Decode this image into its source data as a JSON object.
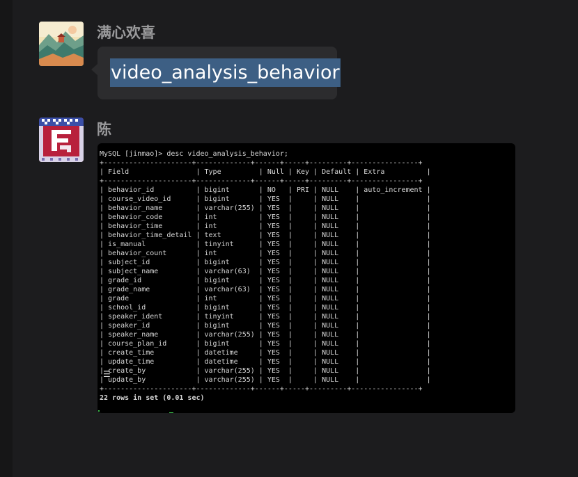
{
  "chat": {
    "messages": [
      {
        "sender": "满心欢喜",
        "text": "video_analysis_behavior",
        "avatar": "landscape-painting-avatar"
      },
      {
        "sender": "陈",
        "avatar": "pixel-art-avatar"
      }
    ]
  },
  "terminal": {
    "command": "MySQL [jinmao]> desc video_analysis_behavior;",
    "separator": "+---------------------+-------------+------+-----+---------+----------------+",
    "columns": [
      "Field",
      "Type",
      "Null",
      "Key",
      "Default",
      "Extra"
    ],
    "rows": [
      [
        "behavior_id",
        "bigint",
        "NO",
        "PRI",
        "NULL",
        "auto_increment"
      ],
      [
        "course_video_id",
        "bigint",
        "YES",
        "",
        "NULL",
        ""
      ],
      [
        "behavior_name",
        "varchar(255)",
        "YES",
        "",
        "NULL",
        ""
      ],
      [
        "behavior_code",
        "int",
        "YES",
        "",
        "NULL",
        ""
      ],
      [
        "behavior_time",
        "int",
        "YES",
        "",
        "NULL",
        ""
      ],
      [
        "behavior_time_detail",
        "text",
        "YES",
        "",
        "NULL",
        ""
      ],
      [
        "is_manual",
        "tinyint",
        "YES",
        "",
        "NULL",
        ""
      ],
      [
        "behavior_count",
        "int",
        "YES",
        "",
        "NULL",
        ""
      ],
      [
        "subject_id",
        "bigint",
        "YES",
        "",
        "NULL",
        ""
      ],
      [
        "subject_name",
        "varchar(63)",
        "YES",
        "",
        "NULL",
        ""
      ],
      [
        "grade_id",
        "bigint",
        "YES",
        "",
        "NULL",
        ""
      ],
      [
        "grade_name",
        "varchar(63)",
        "YES",
        "",
        "NULL",
        ""
      ],
      [
        "grade",
        "int",
        "YES",
        "",
        "NULL",
        ""
      ],
      [
        "school_id",
        "bigint",
        "YES",
        "",
        "NULL",
        ""
      ],
      [
        "speaker_ident",
        "tinyint",
        "YES",
        "",
        "NULL",
        ""
      ],
      [
        "speaker_id",
        "bigint",
        "YES",
        "",
        "NULL",
        ""
      ],
      [
        "speaker_name",
        "varchar(255)",
        "YES",
        "",
        "NULL",
        ""
      ],
      [
        "course_plan_id",
        "bigint",
        "YES",
        "",
        "NULL",
        ""
      ],
      [
        "create_time",
        "datetime",
        "YES",
        "",
        "NULL",
        ""
      ],
      [
        "update_time",
        "datetime",
        "YES",
        "",
        "NULL",
        ""
      ],
      [
        "create_by",
        "varchar(255)",
        "YES",
        "",
        "NULL",
        ""
      ],
      [
        "update_by",
        "varchar(255)",
        "YES",
        "",
        "NULL",
        ""
      ]
    ],
    "footer": "22 rows in set (0.01 sec)"
  },
  "colors": {
    "background": "#1c1c1e",
    "bubble": "#2c2c2e",
    "selection": "#3d5f84",
    "sender_name": "#9a9a9c",
    "terminal_bg": "#000000",
    "terminal_text": "#d8d8d8",
    "cursor": "#3ac34a"
  }
}
